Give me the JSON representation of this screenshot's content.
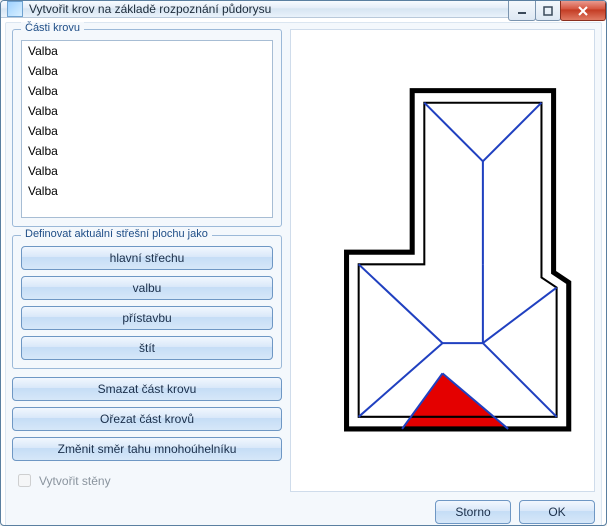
{
  "window": {
    "title": "Vytvořit krov na základě rozpoznání půdorysu"
  },
  "list": {
    "title": "Části krovu",
    "items": [
      "Valba",
      "Valba",
      "Valba",
      "Valba",
      "Valba",
      "Valba",
      "Valba",
      "Valba"
    ]
  },
  "defineGroup": {
    "title": "Definovat aktuální střešní plochu jako",
    "buttons": {
      "mainRoof": "hlavní střechu",
      "hip": "valbu",
      "extension": "přístavbu",
      "gable": "štít"
    }
  },
  "actions": {
    "deletePart": "Smazat část krovu",
    "clipParts": "Ořezat část krovů",
    "reverseDirection": "Změnit směr tahu mnohoúhelníku"
  },
  "options": {
    "createWallsLabel": "Vytvořit stěny",
    "createWallsChecked": false
  },
  "footer": {
    "cancel": "Storno",
    "ok": "OK"
  },
  "colors": {
    "highlight": "#e40000",
    "outline": "#000000",
    "ridge": "#2040c0"
  }
}
